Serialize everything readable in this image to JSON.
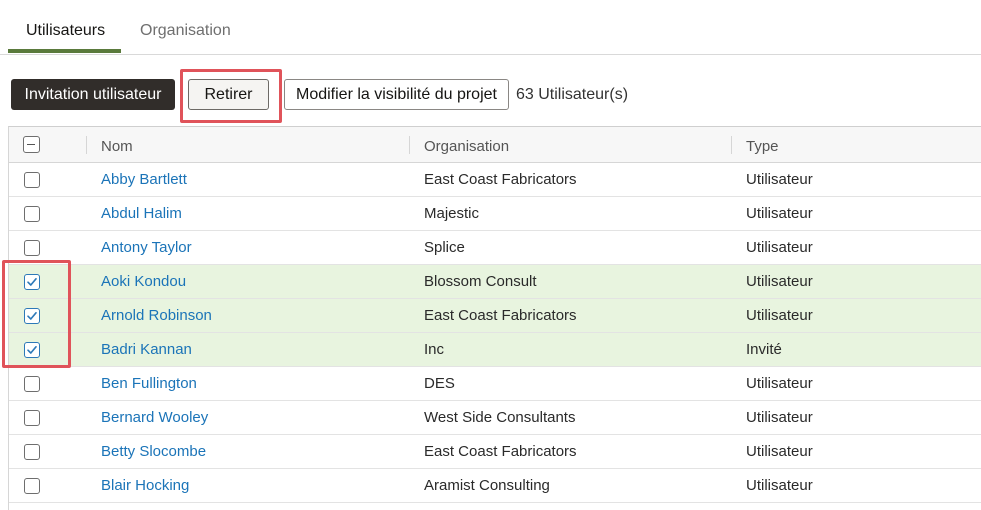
{
  "tabs": [
    {
      "label": "Utilisateurs",
      "active": true
    },
    {
      "label": "Organisation",
      "active": false
    }
  ],
  "toolbar": {
    "invite_label": "Invitation utilisateur",
    "remove_label": "Retirer",
    "visibility_label": "Modifier la visibilité du projet",
    "user_count": "63 Utilisateur(s)"
  },
  "table": {
    "headers": {
      "select_all": "minus-checkbox-icon",
      "name": "Nom",
      "organisation": "Organisation",
      "type": "Type"
    },
    "rows": [
      {
        "name": "Abby Bartlett",
        "organisation": "East Coast Fabricators",
        "type": "Utilisateur",
        "selected": false
      },
      {
        "name": "Abdul Halim",
        "organisation": "Majestic",
        "type": "Utilisateur",
        "selected": false
      },
      {
        "name": "Antony Taylor",
        "organisation": "Splice",
        "type": "Utilisateur",
        "selected": false
      },
      {
        "name": "Aoki Kondou",
        "organisation": "Blossom Consult",
        "type": "Utilisateur",
        "selected": true
      },
      {
        "name": "Arnold Robinson",
        "organisation": "East Coast Fabricators",
        "type": "Utilisateur",
        "selected": true
      },
      {
        "name": "Badri Kannan",
        "organisation": "Inc",
        "type": "Invité",
        "selected": true
      },
      {
        "name": "Ben Fullington",
        "organisation": "DES",
        "type": "Utilisateur",
        "selected": false
      },
      {
        "name": "Bernard Wooley",
        "organisation": "West Side Consultants",
        "type": "Utilisateur",
        "selected": false
      },
      {
        "name": "Betty Slocombe",
        "organisation": "East Coast Fabricators",
        "type": "Utilisateur",
        "selected": false
      },
      {
        "name": "Blair Hocking",
        "organisation": "Aramist Consulting",
        "type": "Utilisateur",
        "selected": false
      }
    ]
  },
  "colors": {
    "accent_tab": "#5a7a3c",
    "primary_button": "#312d2a",
    "link": "#1b74b8",
    "selected_row": "#e8f4df",
    "highlight": "#e0535a"
  }
}
